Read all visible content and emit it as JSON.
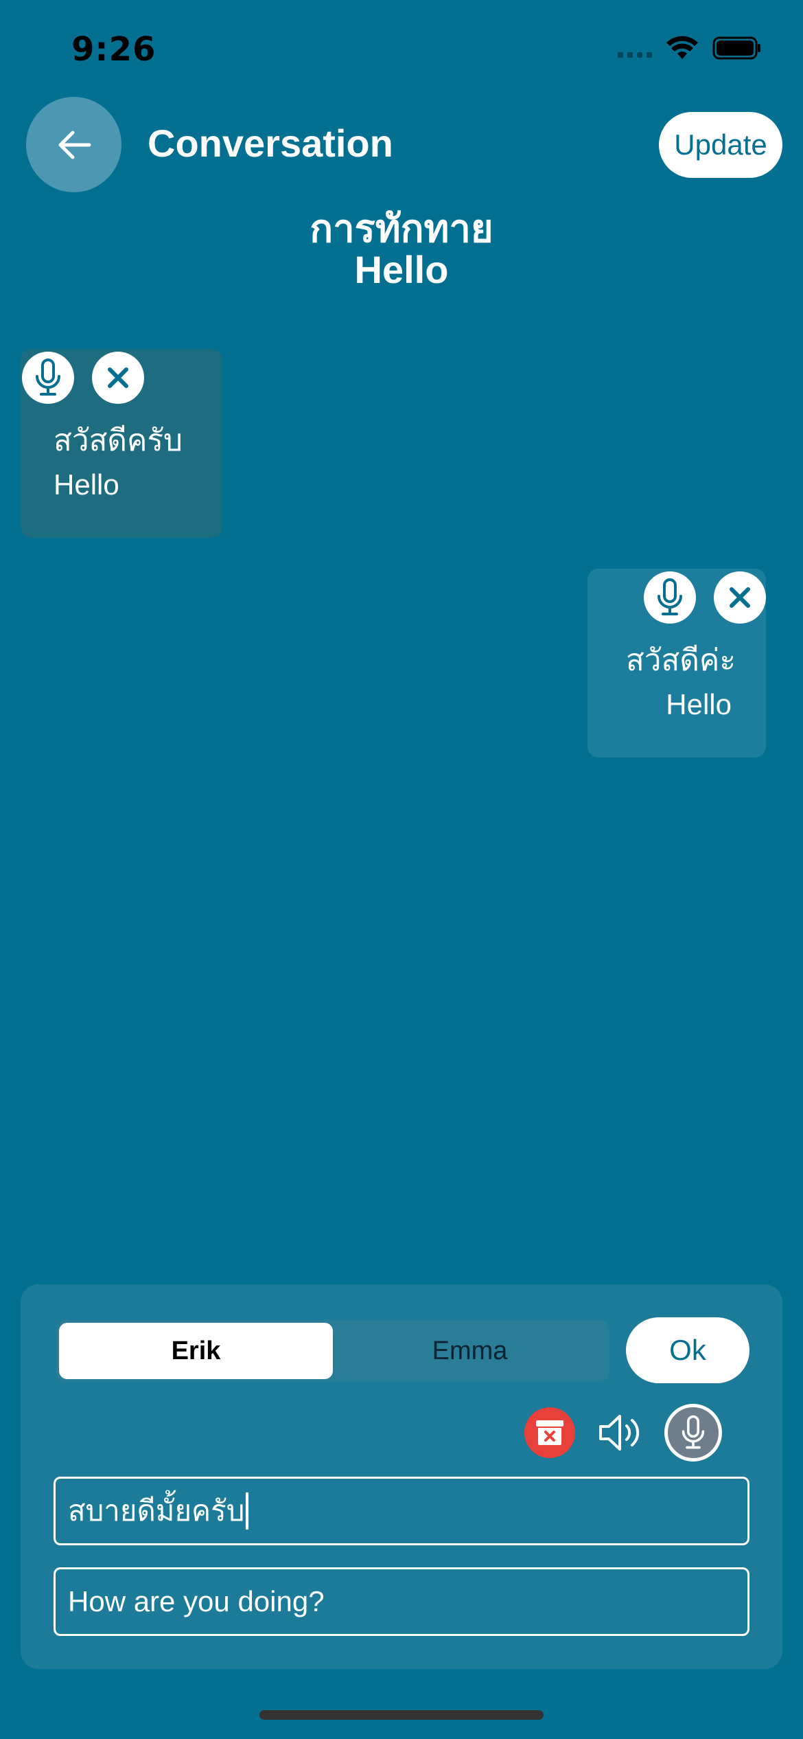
{
  "status_bar": {
    "time": "9:26",
    "icons": [
      "signal-icon",
      "wifi-icon",
      "battery-icon"
    ]
  },
  "header": {
    "title": "Conversation",
    "update_label": "Update",
    "back_icon": "arrow-left-icon"
  },
  "topic": {
    "thai": "การทักทาย",
    "english": "Hello"
  },
  "messages": [
    {
      "side": "left",
      "thai": "สวัสดีครับ",
      "english": "Hello"
    },
    {
      "side": "right",
      "thai": "สวัสดีค่ะ",
      "english": "Hello"
    }
  ],
  "composer": {
    "speakers": [
      "Erik",
      "Emma"
    ],
    "selected_speaker": "Erik",
    "ok_label": "Ok",
    "thai_value": "สบายดีมั้ยครับ",
    "english_value": "How are you doing?",
    "tools": [
      "delete-archive-icon",
      "speaker-icon",
      "microphone-icon"
    ]
  },
  "colors": {
    "background": "#036F91",
    "panel": "#1C7B98",
    "accent_text": "#046F91",
    "delete_red": "#E8403A"
  }
}
